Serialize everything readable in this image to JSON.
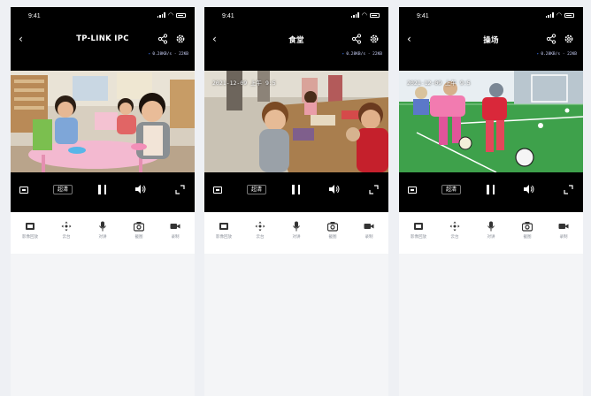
{
  "phones": [
    {
      "status": {
        "time": "9:41"
      },
      "title": "TP-LINK IPC",
      "speed": "0.28KB/s · 22KB",
      "timestamp": "",
      "quality": "超清",
      "tools": [
        "影像回放",
        "云台",
        "对讲",
        "截图",
        "录制"
      ]
    },
    {
      "status": {
        "time": "9:41"
      },
      "title": "食堂",
      "speed": "0.28KB/s · 22KB",
      "timestamp": "2021-12-09 上午 9:5",
      "quality": "超清",
      "tools": [
        "影像回放",
        "云台",
        "对讲",
        "截图",
        "录制"
      ]
    },
    {
      "status": {
        "time": "9:41"
      },
      "title": "操场",
      "speed": "0.28KB/s · 22KB",
      "timestamp": "2021-12-09 上午 9:5",
      "quality": "超清",
      "tools": [
        "影像回放",
        "云台",
        "对讲",
        "截图",
        "录制"
      ]
    }
  ]
}
